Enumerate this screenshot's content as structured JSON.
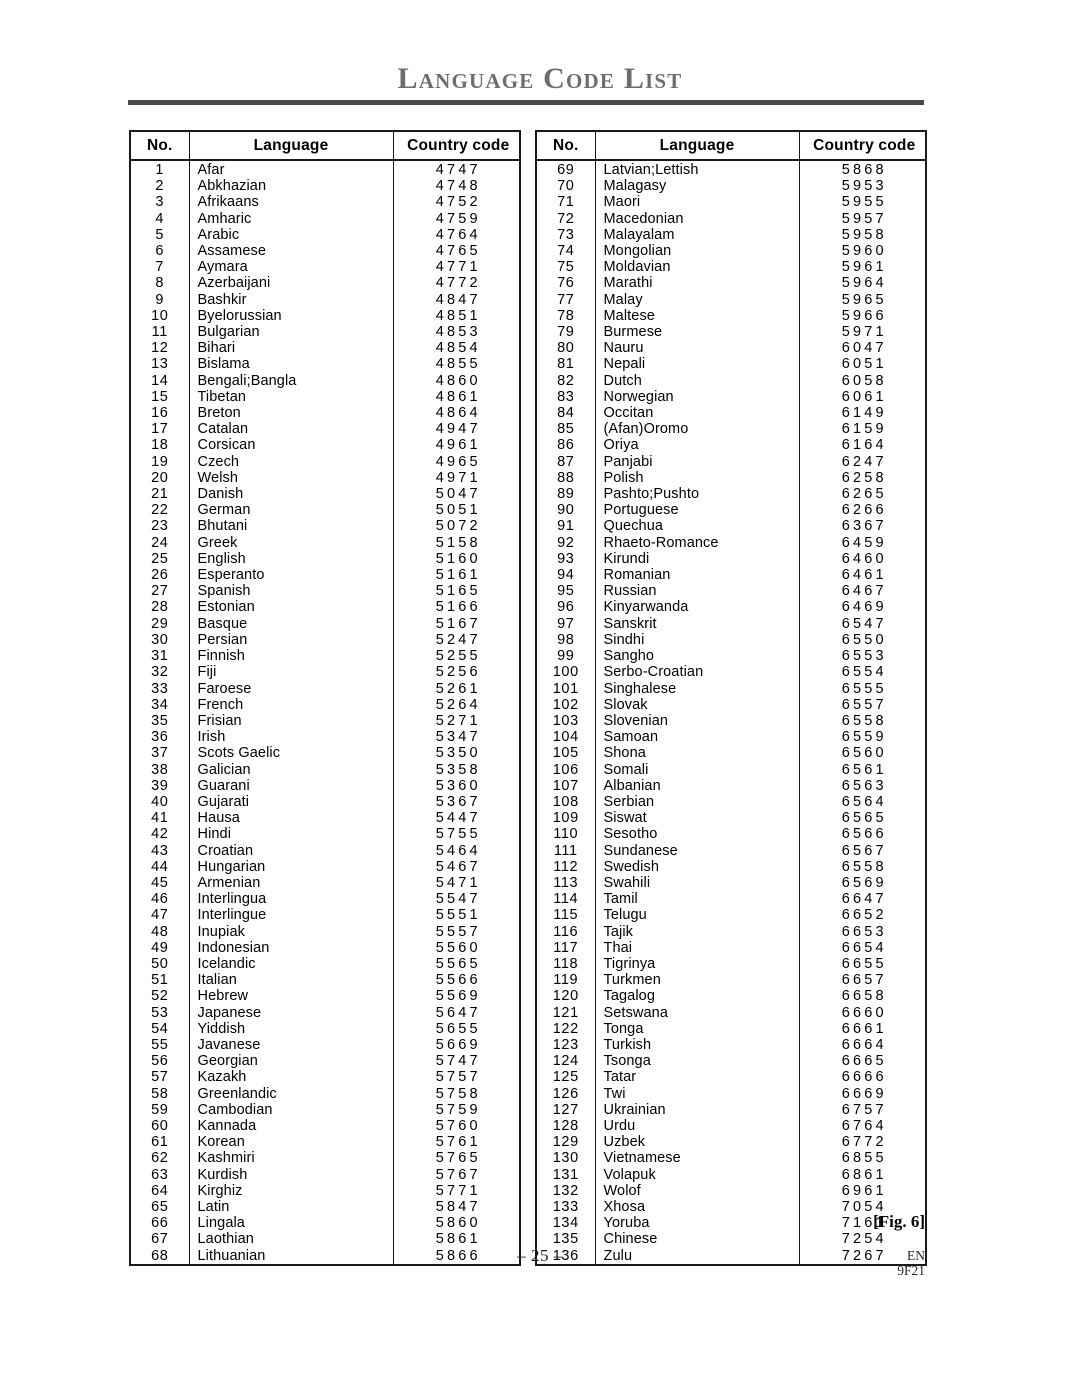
{
  "page": {
    "title": "Language Code List",
    "page_number": "– 25 –",
    "figure_label": "[Fig. 6]",
    "doc_language": "EN",
    "model_code": "9F21",
    "rule_color": "#4a4a4a",
    "title_color": "#6e6e6e",
    "border_color": "#1a1a1a"
  },
  "table_headers": {
    "no": "No.",
    "language": "Language",
    "country_code": "Country code"
  },
  "chart_data": {
    "type": "table",
    "title": "Language Code List",
    "columns": [
      "No.",
      "Language",
      "Country code"
    ],
    "left_column_rows": [
      [
        "1",
        "Afar",
        "4747"
      ],
      [
        "2",
        "Abkhazian",
        "4748"
      ],
      [
        "3",
        "Afrikaans",
        "4752"
      ],
      [
        "4",
        "Amharic",
        "4759"
      ],
      [
        "5",
        "Arabic",
        "4764"
      ],
      [
        "6",
        "Assamese",
        "4765"
      ],
      [
        "7",
        "Aymara",
        "4771"
      ],
      [
        "8",
        "Azerbaijani",
        "4772"
      ],
      [
        "9",
        "Bashkir",
        "4847"
      ],
      [
        "10",
        "Byelorussian",
        "4851"
      ],
      [
        "11",
        "Bulgarian",
        "4853"
      ],
      [
        "12",
        "Bihari",
        "4854"
      ],
      [
        "13",
        "Bislama",
        "4855"
      ],
      [
        "14",
        "Bengali;Bangla",
        "4860"
      ],
      [
        "15",
        "Tibetan",
        "4861"
      ],
      [
        "16",
        "Breton",
        "4864"
      ],
      [
        "17",
        "Catalan",
        "4947"
      ],
      [
        "18",
        "Corsican",
        "4961"
      ],
      [
        "19",
        "Czech",
        "4965"
      ],
      [
        "20",
        "Welsh",
        "4971"
      ],
      [
        "21",
        "Danish",
        "5047"
      ],
      [
        "22",
        "German",
        "5051"
      ],
      [
        "23",
        "Bhutani",
        "5072"
      ],
      [
        "24",
        "Greek",
        "5158"
      ],
      [
        "25",
        "English",
        "5160"
      ],
      [
        "26",
        "Esperanto",
        "5161"
      ],
      [
        "27",
        "Spanish",
        "5165"
      ],
      [
        "28",
        "Estonian",
        "5166"
      ],
      [
        "29",
        "Basque",
        "5167"
      ],
      [
        "30",
        "Persian",
        "5247"
      ],
      [
        "31",
        "Finnish",
        "5255"
      ],
      [
        "32",
        "Fiji",
        "5256"
      ],
      [
        "33",
        "Faroese",
        "5261"
      ],
      [
        "34",
        "French",
        "5264"
      ],
      [
        "35",
        "Frisian",
        "5271"
      ],
      [
        "36",
        "Irish",
        "5347"
      ],
      [
        "37",
        "Scots Gaelic",
        "5350"
      ],
      [
        "38",
        "Galician",
        "5358"
      ],
      [
        "39",
        "Guarani",
        "5360"
      ],
      [
        "40",
        "Gujarati",
        "5367"
      ],
      [
        "41",
        "Hausa",
        "5447"
      ],
      [
        "42",
        "Hindi",
        "5755"
      ],
      [
        "43",
        "Croatian",
        "5464"
      ],
      [
        "44",
        "Hungarian",
        "5467"
      ],
      [
        "45",
        "Armenian",
        "5471"
      ],
      [
        "46",
        "Interlingua",
        "5547"
      ],
      [
        "47",
        "Interlingue",
        "5551"
      ],
      [
        "48",
        "Inupiak",
        "5557"
      ],
      [
        "49",
        "Indonesian",
        "5560"
      ],
      [
        "50",
        "Icelandic",
        "5565"
      ],
      [
        "51",
        "Italian",
        "5566"
      ],
      [
        "52",
        "Hebrew",
        "5569"
      ],
      [
        "53",
        "Japanese",
        "5647"
      ],
      [
        "54",
        "Yiddish",
        "5655"
      ],
      [
        "55",
        "Javanese",
        "5669"
      ],
      [
        "56",
        "Georgian",
        "5747"
      ],
      [
        "57",
        "Kazakh",
        "5757"
      ],
      [
        "58",
        "Greenlandic",
        "5758"
      ],
      [
        "59",
        "Cambodian",
        "5759"
      ],
      [
        "60",
        "Kannada",
        "5760"
      ],
      [
        "61",
        "Korean",
        "5761"
      ],
      [
        "62",
        "Kashmiri",
        "5765"
      ],
      [
        "63",
        "Kurdish",
        "5767"
      ],
      [
        "64",
        "Kirghiz",
        "5771"
      ],
      [
        "65",
        "Latin",
        "5847"
      ],
      [
        "66",
        "Lingala",
        "5860"
      ],
      [
        "67",
        "Laothian",
        "5861"
      ],
      [
        "68",
        "Lithuanian",
        "5866"
      ]
    ],
    "right_column_rows": [
      [
        "69",
        "Latvian;Lettish",
        "5868"
      ],
      [
        "70",
        "Malagasy",
        "5953"
      ],
      [
        "71",
        "Maori",
        "5955"
      ],
      [
        "72",
        "Macedonian",
        "5957"
      ],
      [
        "73",
        "Malayalam",
        "5958"
      ],
      [
        "74",
        "Mongolian",
        "5960"
      ],
      [
        "75",
        "Moldavian",
        "5961"
      ],
      [
        "76",
        "Marathi",
        "5964"
      ],
      [
        "77",
        "Malay",
        "5965"
      ],
      [
        "78",
        "Maltese",
        "5966"
      ],
      [
        "79",
        "Burmese",
        "5971"
      ],
      [
        "80",
        "Nauru",
        "6047"
      ],
      [
        "81",
        "Nepali",
        "6051"
      ],
      [
        "82",
        "Dutch",
        "6058"
      ],
      [
        "83",
        "Norwegian",
        "6061"
      ],
      [
        "84",
        "Occitan",
        "6149"
      ],
      [
        "85",
        "(Afan)Oromo",
        "6159"
      ],
      [
        "86",
        "Oriya",
        "6164"
      ],
      [
        "87",
        "Panjabi",
        "6247"
      ],
      [
        "88",
        "Polish",
        "6258"
      ],
      [
        "89",
        "Pashto;Pushto",
        "6265"
      ],
      [
        "90",
        "Portuguese",
        "6266"
      ],
      [
        "91",
        "Quechua",
        "6367"
      ],
      [
        "92",
        "Rhaeto-Romance",
        "6459"
      ],
      [
        "93",
        "Kirundi",
        "6460"
      ],
      [
        "94",
        "Romanian",
        "6461"
      ],
      [
        "95",
        "Russian",
        "6467"
      ],
      [
        "96",
        "Kinyarwanda",
        "6469"
      ],
      [
        "97",
        "Sanskrit",
        "6547"
      ],
      [
        "98",
        "Sindhi",
        "6550"
      ],
      [
        "99",
        "Sangho",
        "6553"
      ],
      [
        "100",
        "Serbo-Croatian",
        "6554"
      ],
      [
        "101",
        "Singhalese",
        "6555"
      ],
      [
        "102",
        "Slovak",
        "6557"
      ],
      [
        "103",
        "Slovenian",
        "6558"
      ],
      [
        "104",
        "Samoan",
        "6559"
      ],
      [
        "105",
        "Shona",
        "6560"
      ],
      [
        "106",
        "Somali",
        "6561"
      ],
      [
        "107",
        "Albanian",
        "6563"
      ],
      [
        "108",
        "Serbian",
        "6564"
      ],
      [
        "109",
        "Siswat",
        "6565"
      ],
      [
        "110",
        "Sesotho",
        "6566"
      ],
      [
        "111",
        "Sundanese",
        "6567"
      ],
      [
        "112",
        "Swedish",
        "6558"
      ],
      [
        "113",
        "Swahili",
        "6569"
      ],
      [
        "114",
        "Tamil",
        "6647"
      ],
      [
        "115",
        "Telugu",
        "6652"
      ],
      [
        "116",
        "Tajik",
        "6653"
      ],
      [
        "117",
        "Thai",
        "6654"
      ],
      [
        "118",
        "Tigrinya",
        "6655"
      ],
      [
        "119",
        "Turkmen",
        "6657"
      ],
      [
        "120",
        "Tagalog",
        "6658"
      ],
      [
        "121",
        "Setswana",
        "6660"
      ],
      [
        "122",
        "Tonga",
        "6661"
      ],
      [
        "123",
        "Turkish",
        "6664"
      ],
      [
        "124",
        "Tsonga",
        "6665"
      ],
      [
        "125",
        "Tatar",
        "6666"
      ],
      [
        "126",
        "Twi",
        "6669"
      ],
      [
        "127",
        "Ukrainian",
        "6757"
      ],
      [
        "128",
        "Urdu",
        "6764"
      ],
      [
        "129",
        "Uzbek",
        "6772"
      ],
      [
        "130",
        "Vietnamese",
        "6855"
      ],
      [
        "131",
        "Volapuk",
        "6861"
      ],
      [
        "132",
        "Wolof",
        "6961"
      ],
      [
        "133",
        "Xhosa",
        "7054"
      ],
      [
        "134",
        "Yoruba",
        "7161"
      ],
      [
        "135",
        "Chinese",
        "7254"
      ],
      [
        "136",
        "Zulu",
        "7267"
      ]
    ]
  }
}
